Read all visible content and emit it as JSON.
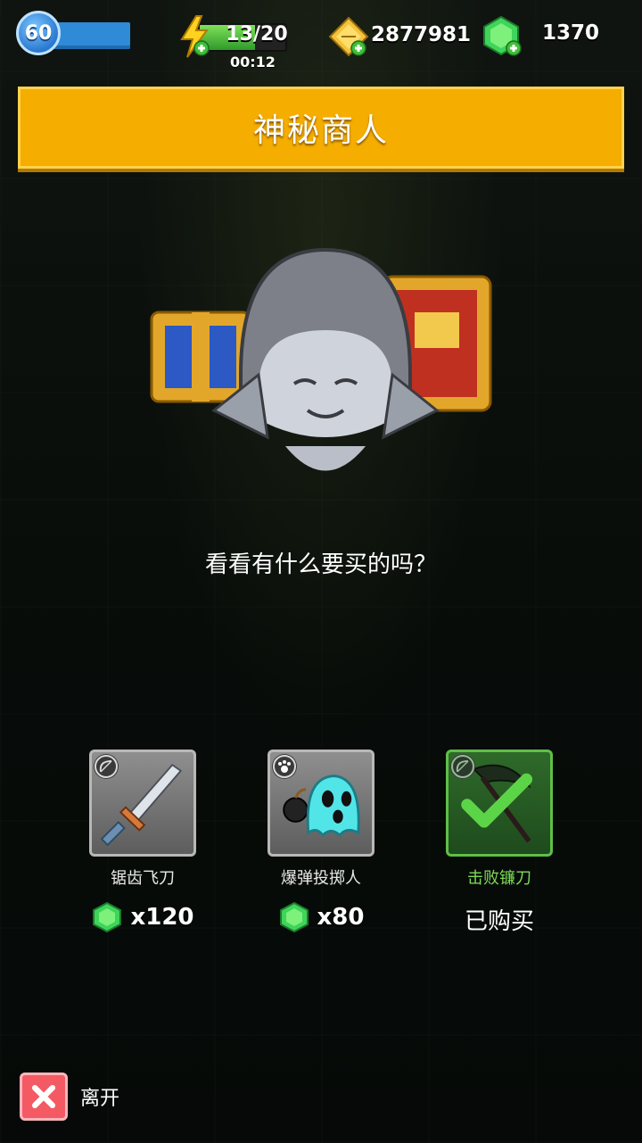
{
  "hud": {
    "level": "60",
    "energy": {
      "value": "13/20",
      "fraction": 0.65,
      "timer": "00:12"
    },
    "gold": "2877981",
    "gems": "1370"
  },
  "title": "神秘商人",
  "prompt": "看看有什么要买的吗？",
  "items": [
    {
      "name": "锯齿飞刀",
      "price": "x120",
      "icon": "sword-icon",
      "tag_icon": "bow-icon"
    },
    {
      "name": "爆弹投掷人",
      "price": "x80",
      "icon": "bomb-ghost-icon",
      "tag_icon": "paw-icon"
    },
    {
      "name": "击败镰刀",
      "status": "已购买",
      "icon": "scythe-icon",
      "tag_icon": "bow-icon"
    }
  ],
  "leave_label": "离开",
  "colors": {
    "banner": "#f5ad00",
    "gem": "#3fd45a",
    "bought": "#7ddc58",
    "close": "#f45a63"
  }
}
